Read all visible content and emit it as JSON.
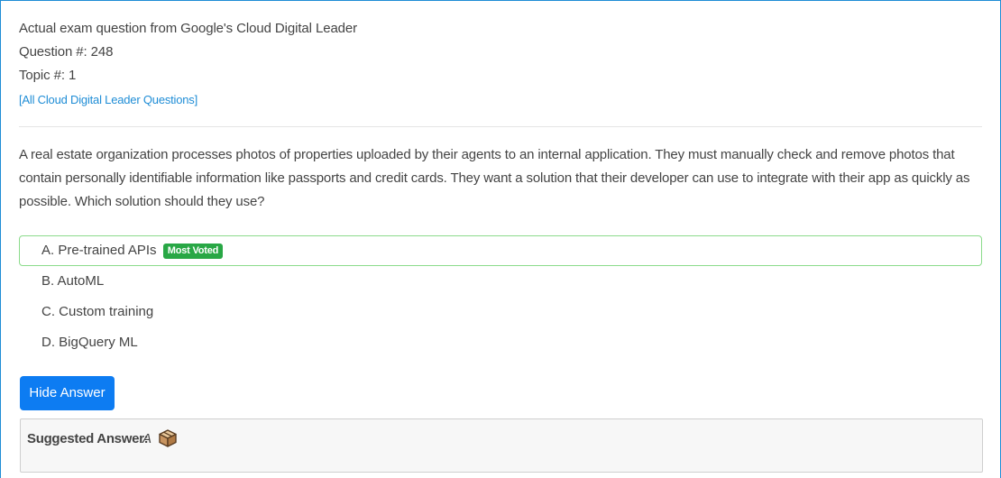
{
  "header": {
    "title": "Actual exam question from Google's Cloud Digital Leader",
    "question_number": "Question #: 248",
    "topic": "Topic #: 1",
    "all_questions_link": "[All Cloud Digital Leader Questions]"
  },
  "question": {
    "text": "A real estate organization processes photos of properties uploaded by their agents to an internal application. They must manually check and remove photos that contain personally identifiable information like passports and credit cards. They want a solution that their developer can use to integrate with their app as quickly as possible. Which solution should they use?"
  },
  "choices": [
    {
      "label": "A. Pre-trained APIs",
      "badge": "Most Voted"
    },
    {
      "label": "B. AutoML"
    },
    {
      "label": "C. Custom training"
    },
    {
      "label": "D. BigQuery ML"
    }
  ],
  "hide_answer_button": "Hide Answer",
  "suggested_answer": {
    "label": "Suggested Answer:",
    "value": "A",
    "icon": "vote-box-icon"
  },
  "colors": {
    "accent_link": "#1f8dd6",
    "button_blue": "#0d7cf2",
    "badge_green": "#28a745",
    "voted_border": "#8bdb8b"
  }
}
